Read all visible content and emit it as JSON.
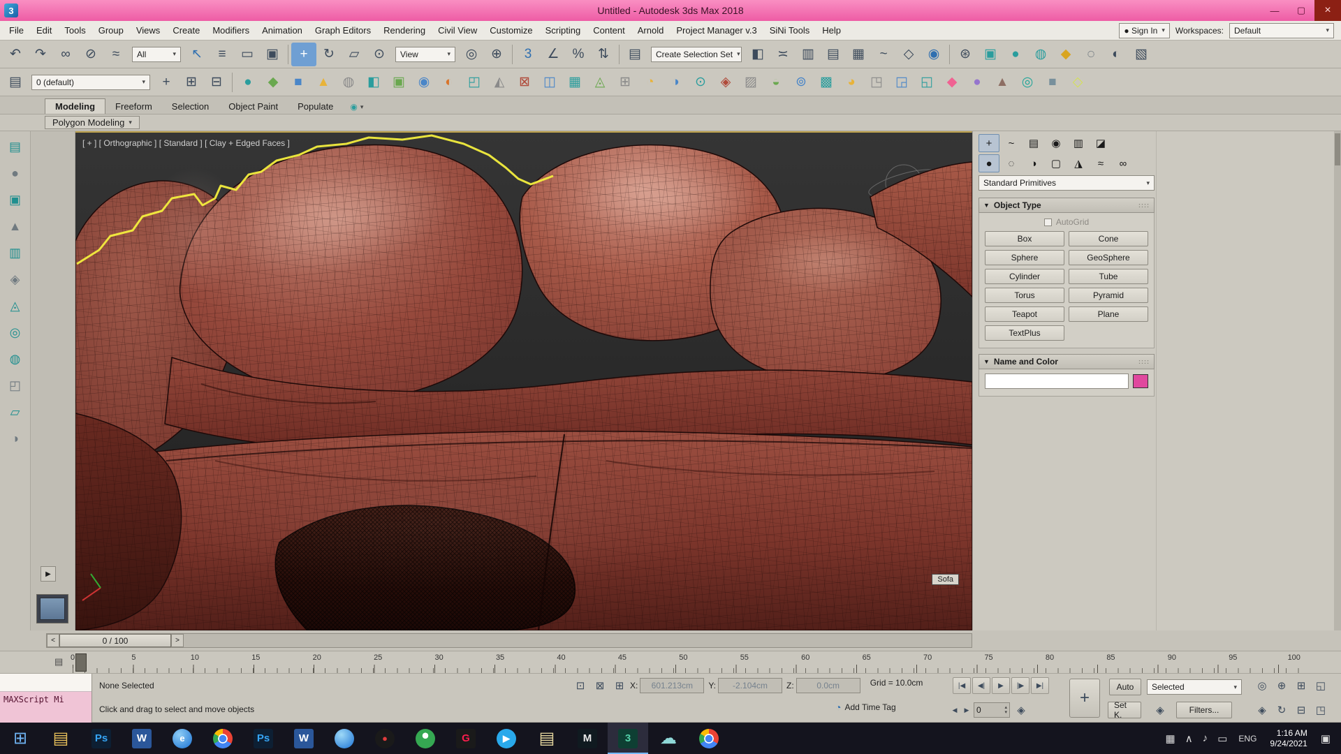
{
  "window": {
    "app_glyph": "3",
    "title": "Untitled - Autodesk 3ds Max 2018",
    "minimize": "—",
    "maximize": "▢",
    "close": "×"
  },
  "menu": {
    "items": [
      "File",
      "Edit",
      "Tools",
      "Group",
      "Views",
      "Create",
      "Modifiers",
      "Animation",
      "Graph Editors",
      "Rendering",
      "Civil View",
      "Customize",
      "Scripting",
      "Content",
      "Arnold",
      "Project Manager v.3",
      "SiNi Tools",
      "Help"
    ],
    "sign_in": "Sign In",
    "workspaces_label": "Workspaces:",
    "workspace_value": "Default",
    "caret": "▾"
  },
  "toolbar1": {
    "all_combo": "All",
    "view_combo": "View",
    "selset_combo": "Create Selection Set",
    "g1": [
      {
        "n": "undo-icon",
        "g": "↶",
        "c": "#3d4b5c"
      },
      {
        "n": "redo-icon",
        "g": "↷",
        "c": "#3d4b5c"
      },
      {
        "n": "select-and-link-icon",
        "g": "∞",
        "c": "#3d4b5c"
      },
      {
        "n": "unlink-selection-icon",
        "g": "⊘",
        "c": "#3d4b5c"
      },
      {
        "n": "bind-to-space-warp-icon",
        "g": "≈",
        "c": "#3d4b5c"
      }
    ],
    "g2": [
      {
        "n": "select-object-icon",
        "g": "↖",
        "c": "#2f6fb0"
      },
      {
        "n": "select-by-name-icon",
        "g": "≡",
        "c": "#3d4b5c"
      },
      {
        "n": "rectangular-selection-region-icon",
        "g": "▭",
        "c": "#3d4b5c"
      },
      {
        "n": "window-crossing-icon",
        "g": "▣",
        "c": "#3d4b5c"
      }
    ],
    "g3": [
      {
        "n": "select-and-move-icon",
        "g": "+",
        "c": "#ffffff",
        "b": "#6f9fd3"
      },
      {
        "n": "select-and-rotate-icon",
        "g": "↻",
        "c": "#3d4b5c"
      },
      {
        "n": "select-and-scale-icon",
        "g": "▱",
        "c": "#3d4b5c"
      },
      {
        "n": "select-and-place-icon",
        "g": "⊙",
        "c": "#3d4b5c"
      }
    ],
    "g4": [
      {
        "n": "use-pivot-point-center-icon",
        "g": "◎",
        "c": "#3d4b5c"
      },
      {
        "n": "use-selection-center-icon",
        "g": "⊕",
        "c": "#3d4b5c"
      }
    ],
    "g5": [
      {
        "n": "snaps-toggle-icon",
        "g": "3",
        "c": "#2f6fb0"
      },
      {
        "n": "angle-snap-icon",
        "g": "∠",
        "c": "#3d4b5c"
      },
      {
        "n": "percent-snap-icon",
        "g": "%",
        "c": "#3d4b5c"
      },
      {
        "n": "spinner-snap-icon",
        "g": "⇅",
        "c": "#3d4b5c"
      }
    ],
    "g6": [
      {
        "n": "edit-named-selection-sets-icon",
        "g": "▤",
        "c": "#3d4b5c"
      }
    ],
    "g7": [
      {
        "n": "mirror-icon",
        "g": "◧",
        "c": "#3d4b5c"
      },
      {
        "n": "align-icon",
        "g": "≍",
        "c": "#3d4b5c"
      },
      {
        "n": "toggle-scene-explorer-icon",
        "g": "▥",
        "c": "#3d4b5c"
      },
      {
        "n": "toggle-layer-explorer-icon",
        "g": "▤",
        "c": "#3d4b5c"
      },
      {
        "n": "toggle-ribbon-icon",
        "g": "▦",
        "c": "#3d4b5c"
      },
      {
        "n": "curve-editor-icon",
        "g": "~",
        "c": "#3d4b5c"
      },
      {
        "n": "schematic-view-icon",
        "g": "◇",
        "c": "#3d4b5c"
      },
      {
        "n": "material-editor-icon",
        "g": "◉",
        "c": "#2f6fb0"
      }
    ],
    "g8": [
      {
        "n": "render-setup-icon",
        "g": "⊛",
        "c": "#3d4b5c"
      },
      {
        "n": "rendered-frame-window-icon",
        "g": "▣",
        "c": "#2a9d9d"
      },
      {
        "n": "render-production-icon",
        "g": "●",
        "c": "#2a9d9d"
      },
      {
        "n": "render-in-cloud-icon",
        "g": "◍",
        "c": "#2a9d9d"
      },
      {
        "n": "open-autodesk-app-icon",
        "g": "◆",
        "c": "#d9a520"
      },
      {
        "n": "isolate-selection-icon",
        "g": "◌",
        "c": "#3d4b5c"
      },
      {
        "n": "display-toggle-icon",
        "g": "◐",
        "c": "#3d4b5c"
      },
      {
        "n": "scene-states-icon",
        "g": "▧",
        "c": "#3d4b5c"
      }
    ]
  },
  "toolbar2": {
    "layer_combo": "0 (default)",
    "lead": [
      {
        "n": "layer-manager-icon",
        "g": "▤",
        "c": "#3d4b5c"
      }
    ],
    "g1": [
      {
        "n": "create-new-layer-icon",
        "g": "+",
        "c": "#3d4b5c"
      },
      {
        "n": "add-selection-to-layer-icon",
        "g": "⊞",
        "c": "#3d4b5c"
      },
      {
        "n": "select-objects-in-layer-icon",
        "g": "⊟",
        "c": "#3d4b5c"
      }
    ],
    "g2": [
      {
        "n": "sini-tool-icon",
        "g": "●",
        "c": "#2a9d9d"
      },
      {
        "n": "sini-tool-icon",
        "g": "◆",
        "c": "#6aa84f"
      },
      {
        "n": "sini-tool-icon",
        "g": "■",
        "c": "#4a86c8"
      },
      {
        "n": "sini-tool-icon",
        "g": "▲",
        "c": "#e8b339"
      },
      {
        "n": "sini-tool-icon",
        "g": "◍",
        "c": "#8a8a8a"
      },
      {
        "n": "sini-tool-icon",
        "g": "◧",
        "c": "#2a9d9d"
      },
      {
        "n": "sini-tool-icon",
        "g": "▣",
        "c": "#6aa84f"
      },
      {
        "n": "sini-tool-icon",
        "g": "◉",
        "c": "#4a86c8"
      },
      {
        "n": "sini-tool-icon",
        "g": "◐",
        "c": "#d9742a"
      },
      {
        "n": "sini-tool-icon",
        "g": "◰",
        "c": "#2a9d9d"
      },
      {
        "n": "sini-tool-icon",
        "g": "◭",
        "c": "#8a8a8a"
      },
      {
        "n": "sini-tool-icon",
        "g": "⊠",
        "c": "#b04a3a"
      },
      {
        "n": "sini-tool-icon",
        "g": "◫",
        "c": "#4a86c8"
      },
      {
        "n": "sini-tool-icon",
        "g": "▦",
        "c": "#2a9d9d"
      },
      {
        "n": "sini-tool-icon",
        "g": "◬",
        "c": "#6aa84f"
      },
      {
        "n": "sini-tool-icon",
        "g": "⊞",
        "c": "#8a8a8a"
      },
      {
        "n": "sini-tool-icon",
        "g": "◔",
        "c": "#e8b339"
      },
      {
        "n": "sini-tool-icon",
        "g": "◑",
        "c": "#4a86c8"
      },
      {
        "n": "sini-tool-icon",
        "g": "⊙",
        "c": "#2a9d9d"
      },
      {
        "n": "sini-tool-icon",
        "g": "◈",
        "c": "#b04a3a"
      },
      {
        "n": "sini-tool-icon",
        "g": "▨",
        "c": "#8a8a8a"
      },
      {
        "n": "sini-tool-icon",
        "g": "◒",
        "c": "#6aa84f"
      },
      {
        "n": "sini-tool-icon",
        "g": "⊚",
        "c": "#4a86c8"
      },
      {
        "n": "sini-tool-icon",
        "g": "▩",
        "c": "#2a9d9d"
      },
      {
        "n": "sini-tool-icon",
        "g": "◕",
        "c": "#e8b339"
      },
      {
        "n": "sini-tool-icon",
        "g": "◳",
        "c": "#8a8a8a"
      },
      {
        "n": "sini-tool-icon",
        "g": "◲",
        "c": "#4a86c8"
      },
      {
        "n": "sini-tool-icon",
        "g": "◱",
        "c": "#2a9d9d"
      },
      {
        "n": "sini-tool-icon",
        "g": "◆",
        "c": "#f06292"
      },
      {
        "n": "sini-tool-icon",
        "g": "●",
        "c": "#9575cd"
      },
      {
        "n": "sini-tool-icon",
        "g": "▲",
        "c": "#8d6e63"
      },
      {
        "n": "sini-tool-icon",
        "g": "◎",
        "c": "#26a69a"
      },
      {
        "n": "sini-tool-icon",
        "g": "■",
        "c": "#78909c"
      },
      {
        "n": "sini-tool-icon",
        "g": "◇",
        "c": "#d4e157"
      }
    ]
  },
  "ribbon": {
    "tabs": [
      {
        "label": "Modeling",
        "cls": "active"
      },
      {
        "label": "Freeform"
      },
      {
        "label": "Selection"
      },
      {
        "label": "Object Paint"
      },
      {
        "label": "Populate"
      }
    ],
    "extra_icon": "◉",
    "caret": "▾",
    "subtab": "Polygon Modeling"
  },
  "leftbar": {
    "icons": [
      {
        "n": "scene-explorer-icon",
        "g": "▤",
        "c": "#1f8f8f"
      },
      {
        "n": "sphere-tool-icon",
        "g": "●",
        "c": "#707a80"
      },
      {
        "n": "box-tool-icon",
        "g": "▣",
        "c": "#1f8f8f"
      },
      {
        "n": "cone-tool-icon",
        "g": "▲",
        "c": "#707a80"
      },
      {
        "n": "book-tool-icon",
        "g": "▥",
        "c": "#1f8f8f"
      },
      {
        "n": "gem-tool-icon",
        "g": "◈",
        "c": "#707a80"
      },
      {
        "n": "pen-tool-icon",
        "g": "◬",
        "c": "#1f8f8f"
      },
      {
        "n": "torus-tool-icon",
        "g": "◎",
        "c": "#1f8f8f"
      },
      {
        "n": "teapot-tool-icon",
        "g": "◍",
        "c": "#1f8f8f"
      },
      {
        "n": "container-tool-icon",
        "g": "◰",
        "c": "#707a80"
      },
      {
        "n": "plane-tool-icon",
        "g": "▱",
        "c": "#1f8f8f"
      },
      {
        "n": "lamp-tool-icon",
        "g": "◑",
        "c": "#707a80"
      }
    ]
  },
  "viewport": {
    "label": "[ + ] [ Orthographic ] [ Standard ] [ Clay + Edged Faces ]",
    "tooltip": "Sofa"
  },
  "panel": {
    "tabs": [
      {
        "n": "create-tab-icon",
        "g": "+",
        "c": "#1a1a1a",
        "cls": "active"
      },
      {
        "n": "modify-tab-icon",
        "g": "~",
        "c": "#1a1a1a"
      },
      {
        "n": "hierarchy-tab-icon",
        "g": "▤",
        "c": "#1a1a1a"
      },
      {
        "n": "motion-tab-icon",
        "g": "◉",
        "c": "#1a1a1a"
      },
      {
        "n": "display-tab-icon",
        "g": "▥",
        "c": "#1a1a1a"
      },
      {
        "n": "utilities-tab-icon",
        "g": "◪",
        "c": "#1a1a1a"
      }
    ],
    "categories": [
      {
        "n": "geometry-category-icon",
        "g": "●",
        "c": "#1a1a1a",
        "cls": "active"
      },
      {
        "n": "shapes-category-icon",
        "g": "◌",
        "c": "#1a1a1a"
      },
      {
        "n": "lights-category-icon",
        "g": "◑",
        "c": "#1a1a1a"
      },
      {
        "n": "cameras-category-icon",
        "g": "▢",
        "c": "#1a1a1a"
      },
      {
        "n": "helpers-category-icon",
        "g": "◮",
        "c": "#1a1a1a"
      },
      {
        "n": "space-warps-category-icon",
        "g": "≈",
        "c": "#1a1a1a"
      },
      {
        "n": "systems-category-icon",
        "g": "∞",
        "c": "#1a1a1a"
      }
    ],
    "dropdown": "Standard Primitives",
    "object_type": {
      "title": "Object Type",
      "arrow": "▼",
      "grip": "::::",
      "autogrid": "AutoGrid",
      "buttons": [
        "Box",
        "Cone",
        "Sphere",
        "GeoSphere",
        "Cylinder",
        "Tube",
        "Torus",
        "Pyramid",
        "Teapot",
        "Plane",
        "TextPlus"
      ]
    },
    "name_color": {
      "title": "Name and Color",
      "arrow": "▼",
      "grip": "::::",
      "swatch_color": "#e0489e"
    }
  },
  "timeline": {
    "prev": "<",
    "next": ">",
    "handle": "0 / 100",
    "cfg_icon": "▤",
    "ruler": [
      "0",
      "5",
      "10",
      "15",
      "20",
      "25",
      "30",
      "35",
      "40",
      "45",
      "50",
      "55",
      "60",
      "65",
      "70",
      "75",
      "80",
      "85",
      "90",
      "95",
      "100"
    ]
  },
  "status": {
    "maxscript": "MAXScript Mi",
    "selection": "None Selected",
    "prompt": "Click and drag to select and move objects",
    "mid_icons": [
      {
        "n": "transform-gizmo-icon",
        "g": "⊡",
        "c": "#3d4b5c"
      },
      {
        "n": "selection-lock-icon",
        "g": "⊠",
        "c": "#3d4b5c"
      },
      {
        "n": "absolute-mode-icon",
        "g": "⊞",
        "c": "#3d4b5c"
      }
    ],
    "x_label": "X:",
    "x_value": "601.213cm",
    "y_label": "Y:",
    "y_value": "-2.104cm",
    "z_label": "Z:",
    "z_value": "0.0cm",
    "grid": "Grid = 10.0cm",
    "time_tag_icon": "◔",
    "time_tag": "Add Time Tag",
    "playback": [
      {
        "n": "go-to-start-button",
        "g": "|◀"
      },
      {
        "n": "previous-frame-button",
        "g": "◀|"
      },
      {
        "n": "play-button",
        "g": "▶"
      },
      {
        "n": "next-frame-button",
        "g": "|▶"
      },
      {
        "n": "go-to-end-button",
        "g": "▶|"
      }
    ],
    "frame_nav_prev": "◀",
    "frame_nav_next": "▶",
    "frame_value": "0",
    "spin_up": "▴",
    "spin_down": "▾",
    "key_filter_icon": "◈",
    "set_keys_glyph": "+",
    "auto": "Auto",
    "selected_combo": "Selected",
    "set_k": "Set K.",
    "filters": "Filters...",
    "nav1": [
      {
        "n": "zoom-icon",
        "g": "◎"
      },
      {
        "n": "zoom-all-icon",
        "g": "⊕"
      },
      {
        "n": "zoom-extents-icon",
        "g": "⊞"
      },
      {
        "n": "zoom-region-icon",
        "g": "◱"
      }
    ],
    "nav2": [
      {
        "n": "pan-icon",
        "g": "◈"
      },
      {
        "n": "orbit-icon",
        "g": "↻"
      },
      {
        "n": "min-viewport-icon",
        "g": "⊟"
      },
      {
        "n": "max-viewport-toggle-icon",
        "g": "◳"
      }
    ]
  },
  "taskbar": {
    "start_glyph": "⊞",
    "icons": [
      {
        "n": "file-explorer-icon",
        "cls": "tb-glyph",
        "g": "▤",
        "c": "#e8c05a"
      },
      {
        "n": "photoshop-icon",
        "cls": "tb-tile",
        "g": "Ps",
        "b": "#0d1f33",
        "c": "#35a4f4"
      },
      {
        "n": "word-icon",
        "cls": "tb-tile",
        "g": "W",
        "b": "#2b579a",
        "c": "#ffffff"
      },
      {
        "n": "browser-globe-icon",
        "cls": "tb-circle",
        "g": "e",
        "b": "radial-gradient(circle at 35% 30%,#8ecdf5,#1b72d4)",
        "c": "#ffffff"
      },
      {
        "n": "chrome-icon",
        "cls": "tb-circle",
        "g": "",
        "b": "radial-gradient(circle,#4285f4 0 26%,#ffffff 27% 34%,rgba(0,0,0,0) 35%),conic-gradient(#ea4335 0 120deg,#4285f4 120deg 240deg,#34a853 240deg 300deg,#fbbc05 300deg 360deg)"
      },
      {
        "n": "photoshop-icon",
        "cls": "tb-tile",
        "g": "Ps",
        "b": "#0d1f33",
        "c": "#35a4f4"
      },
      {
        "n": "word-icon",
        "cls": "tb-tile",
        "g": "W",
        "b": "#2b579a",
        "c": "#ffffff"
      },
      {
        "n": "globe-icon",
        "cls": "tb-circle",
        "g": "",
        "b": "radial-gradient(circle at 35% 30%,#9ed9f7,#1b72d4)"
      },
      {
        "n": "record-app-icon",
        "cls": "tb-circle",
        "g": "●",
        "b": "#1a1a1a",
        "c": "#e03c3c"
      },
      {
        "n": "mushroom-icon",
        "cls": "tb-circle",
        "g": "",
        "b": "radial-gradient(circle at 50% 35%,#ffffff 0 18%,#35a852 19%)"
      },
      {
        "n": "opera-gx-icon",
        "cls": "tb-tile",
        "g": "G",
        "b": "#1a1a1a",
        "c": "#fa1e4e"
      },
      {
        "n": "telegram-icon",
        "cls": "tb-circle",
        "g": "▶",
        "b": "#29a9eb",
        "c": "#ffffff"
      },
      {
        "n": "folder-icon",
        "cls": "tb-glyph",
        "g": "▤",
        "c": "#e8d9a0"
      },
      {
        "n": "maya-icon",
        "cls": "tb-tile",
        "g": "M",
        "b": "#101a20",
        "c": "#e8e8e8"
      },
      {
        "n": "3dsmax-icon",
        "cls": "tb-tile",
        "g": "3",
        "b": "#0e3f33",
        "c": "#53d0a8",
        "active": "active"
      },
      {
        "n": "cloud-app-icon",
        "cls": "tb-glyph",
        "g": "☁",
        "c": "#8fd8d8"
      },
      {
        "n": "chrome-icon",
        "cls": "tb-circle",
        "g": "",
        "b": "radial-gradient(circle,#4285f4 0 26%,#ffffff 27% 34%,rgba(0,0,0,0) 35%),conic-gradient(#ea4335 0 120deg,#4285f4 120deg 240deg,#34a853 240deg 300deg,#fbbc05 300deg 360deg)"
      }
    ],
    "tray": [
      {
        "n": "touch-keyboard-icon",
        "g": "▦"
      },
      {
        "n": "hidden-icons-chevron",
        "g": "∧"
      },
      {
        "n": "volume-icon",
        "g": "♪"
      },
      {
        "n": "battery-icon",
        "g": "▭"
      }
    ],
    "lang": "ENG",
    "time": "1:16 AM",
    "date": "9/24/2021",
    "notification_icon": "▣"
  }
}
